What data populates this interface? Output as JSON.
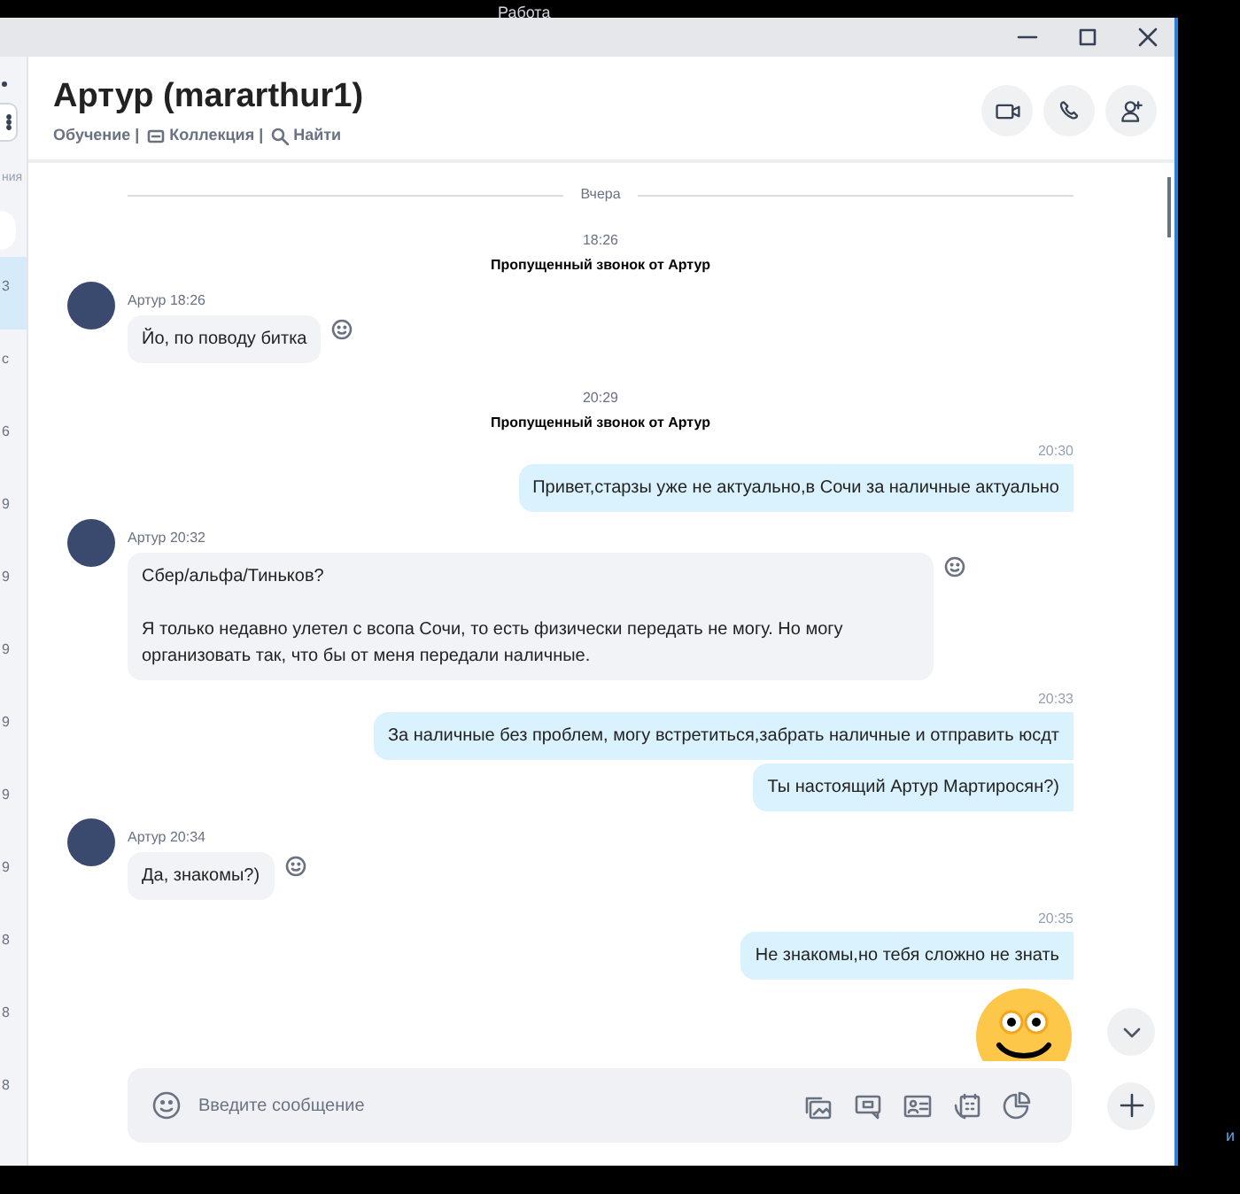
{
  "taskbar": {
    "label": "Работа"
  },
  "sidebar": {
    "section_label": "ния",
    "items": [
      {
        "text": "3",
        "selected": true
      },
      {
        "text": "с",
        "selected": false
      },
      {
        "text": "6",
        "selected": false
      },
      {
        "text": "9",
        "selected": false
      },
      {
        "text": "9",
        "selected": false
      },
      {
        "text": "9",
        "selected": false
      },
      {
        "text": "9",
        "selected": false
      },
      {
        "text": "9",
        "selected": false
      },
      {
        "text": "9",
        "selected": false
      },
      {
        "text": "8",
        "selected": false
      },
      {
        "text": "8",
        "selected": false
      },
      {
        "text": "8",
        "selected": false
      }
    ]
  },
  "header": {
    "title": "Артур (mararthur1)",
    "links": [
      {
        "kind": "plain",
        "label": "Обучение |"
      },
      {
        "kind": "gallery",
        "label": "Коллекция |"
      },
      {
        "kind": "search",
        "label": "Найти"
      }
    ]
  },
  "messages": [
    {
      "kind": "divider",
      "text": "Вчера"
    },
    {
      "kind": "missed_call",
      "time": "18:26",
      "text": "Пропущенный звонок от Артур"
    },
    {
      "kind": "incoming",
      "author": "Артур",
      "time": "18:26",
      "bubbles": [
        "Йо, по поводу битка"
      ]
    },
    {
      "kind": "missed_call",
      "time": "20:29",
      "text": "Пропущенный звонок от Артур"
    },
    {
      "kind": "outgoing",
      "time": "20:30",
      "bubbles": [
        "Привет,старзы уже не актуально,в Сочи за наличные актуально"
      ]
    },
    {
      "kind": "incoming",
      "author": "Артур",
      "time": "20:32",
      "bubbles": [
        "Сбер/альфа/Тиньков?\n\nЯ только недавно улетел с всопа Сочи, то есть физически передать не могу. Но могу организовать так, что бы от меня передали наличные."
      ]
    },
    {
      "kind": "outgoing",
      "time": "20:33",
      "bubbles": [
        "За наличные без проблем, могу встретиться,забрать наличные и отправить юсдт",
        "Ты настоящий Артур Мартиросян?)"
      ]
    },
    {
      "kind": "incoming",
      "author": "Артур",
      "time": "20:34",
      "bubbles": [
        "Да, знакомы?)"
      ]
    },
    {
      "kind": "outgoing",
      "time": "20:35",
      "bubbles": [
        "Не знакомы,но тебя сложно не знать"
      ]
    },
    {
      "kind": "sticker"
    }
  ],
  "composer": {
    "placeholder": "Введите сообщение"
  },
  "corner_text": "и"
}
